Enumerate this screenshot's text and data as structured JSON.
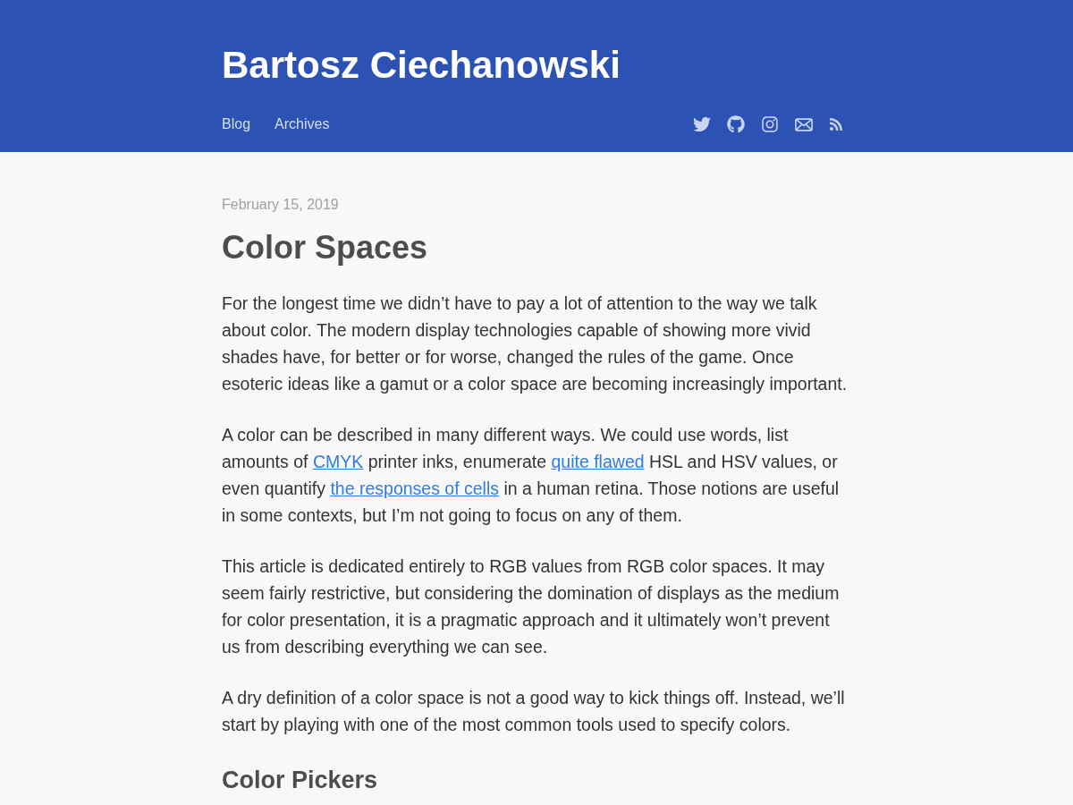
{
  "header": {
    "title": "Bartosz Ciechanowski",
    "nav": [
      {
        "label": "Blog"
      },
      {
        "label": "Archives"
      }
    ]
  },
  "article": {
    "date": "February 15, 2019",
    "title": "Color Spaces",
    "blocks": [
      {
        "kind": "paragraph",
        "parts": [
          {
            "kind": "text",
            "text": "For the longest time we didn’t have to pay a lot of attention to the way we talk about color. The modern display technologies capable of showing more vivid shades have, for better or for worse, changed the rules of the game. Once esoteric ideas like a gamut or a color space are becoming increasingly important."
          }
        ]
      },
      {
        "kind": "paragraph",
        "parts": [
          {
            "kind": "text",
            "text": "A color can be described in many different ways. We could use words, list amounts of "
          },
          {
            "kind": "link",
            "text": "CMYK"
          },
          {
            "kind": "text",
            "text": " printer inks, enumerate "
          },
          {
            "kind": "link",
            "text": "quite flawed"
          },
          {
            "kind": "text",
            "text": " HSL and HSV values, or even quantify "
          },
          {
            "kind": "link",
            "text": "the responses of cells"
          },
          {
            "kind": "text",
            "text": " in a human retina. Those notions are useful in some contexts, but I’m not going to focus on any of them."
          }
        ]
      },
      {
        "kind": "paragraph",
        "parts": [
          {
            "kind": "text",
            "text": "This article is dedicated entirely to RGB values from RGB color spaces. It may seem fairly restrictive, but considering the domination of displays as the medium for color presentation, it is a pragmatic approach and it ultimately won’t prevent us from describing everything we can see."
          }
        ]
      },
      {
        "kind": "paragraph",
        "parts": [
          {
            "kind": "text",
            "text": "A dry definition of a color space is not a good way to kick things off. Instead, we’ll start by playing with one of the most common tools used to specify colors."
          }
        ]
      },
      {
        "kind": "heading",
        "text": "Color Pickers"
      }
    ]
  }
}
